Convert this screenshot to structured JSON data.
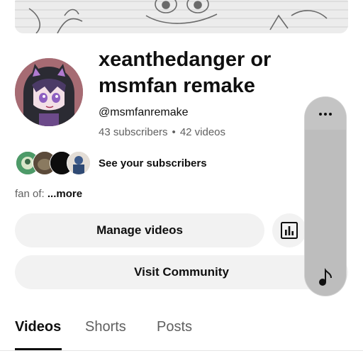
{
  "channel": {
    "name": "xeanthedanger or msmfan remake",
    "handle": "@msmfanremake",
    "subscribers": "43 subscribers",
    "separator": "•",
    "videos": "42 videos"
  },
  "subscribers_row": {
    "label": "See your subscribers"
  },
  "about": {
    "prefix": "fan of: ",
    "more": "...more"
  },
  "buttons": {
    "manage_videos": "Manage videos",
    "analytics_icon": "analytics-icon",
    "visit_community": "Visit Community"
  },
  "tabs": [
    {
      "label": "Videos",
      "active": true
    },
    {
      "label": "Shorts",
      "active": false
    },
    {
      "label": "Posts",
      "active": false
    }
  ],
  "floating_panel": {
    "more_icon": "more-horizontal-icon",
    "media_icon": "music-note-icon"
  },
  "colors": {
    "button_bg": "#f2f2f2",
    "secondary_text": "#606060",
    "primary_text": "#0f0f0f",
    "panel_bg": "#bdbdbd"
  }
}
